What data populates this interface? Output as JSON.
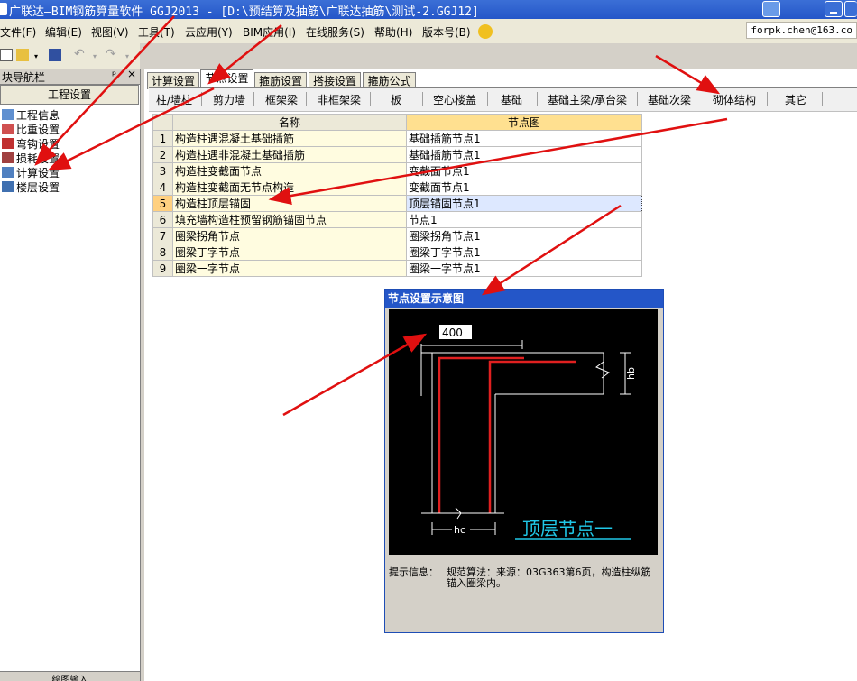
{
  "window": {
    "title": "广联达—BIM钢筋算量软件 GGJ2013 - [D:\\预结算及抽筋\\广联达抽筋\\测试-2.GGJ12]"
  },
  "menu": [
    "文件(F)",
    "编辑(E)",
    "视图(V)",
    "工具(T)",
    "云应用(Y)",
    "BIM应用(I)",
    "在线服务(S)",
    "帮助(H)",
    "版本号(B)"
  ],
  "user": "forpk.chen@163.co",
  "left_panel": {
    "header": "块导航栏",
    "pin": "ᵖ",
    "close": "×",
    "section": "工程设置",
    "items": [
      "工程信息",
      "比重设置",
      "弯钩设置",
      "损耗设置",
      "计算设置",
      "楼层设置"
    ],
    "bottom": "绘图输入"
  },
  "tabs": [
    "计算设置",
    "节点设置",
    "箍筋设置",
    "搭接设置",
    "箍筋公式"
  ],
  "active_tab": 1,
  "subtabs": [
    "柱/墙柱",
    "剪力墙",
    "框架梁",
    "非框架梁",
    "板",
    "空心楼盖",
    "基础",
    "基础主梁/承台梁",
    "基础次梁",
    "砌体结构",
    "其它"
  ],
  "table": {
    "headers": [
      "名称",
      "节点图"
    ],
    "rows": [
      {
        "num": "1",
        "name": "构造柱遇混凝土基础插筋",
        "node": "基础插筋节点1"
      },
      {
        "num": "2",
        "name": "构造柱遇非混凝土基础插筋",
        "node": "基础插筋节点1"
      },
      {
        "num": "3",
        "name": "构造柱变截面节点",
        "node": "变截面节点1"
      },
      {
        "num": "4",
        "name": "构造柱变截面无节点构造",
        "node": "变截面节点1"
      },
      {
        "num": "5",
        "name": "构造柱顶层锚固",
        "node": "顶层锚固节点1"
      },
      {
        "num": "6",
        "name": "填充墙构造柱预留钢筋锚固节点",
        "node": "节点1"
      },
      {
        "num": "7",
        "name": "圈梁拐角节点",
        "node": "圈梁拐角节点1"
      },
      {
        "num": "8",
        "name": "圈梁丁字节点",
        "node": "圈梁丁字节点1"
      },
      {
        "num": "9",
        "name": "圈梁一字节点",
        "node": "圈梁一字节点1"
      }
    ]
  },
  "dialog": {
    "title": "节点设置示意图",
    "diagram": {
      "input_value": "400",
      "dim_hb": "hb",
      "dim_hc": "hc",
      "caption": "顶层节点一"
    },
    "info_label": "提示信息：",
    "info_text": "规范算法：来源：03G363第6页，构造柱纵筋锚入圈梁内。"
  },
  "colors": {
    "titlebar": "#2456c8",
    "rebar": "#e02020",
    "caption": "#20c8e8",
    "annotation_arrow": "#e01010"
  }
}
